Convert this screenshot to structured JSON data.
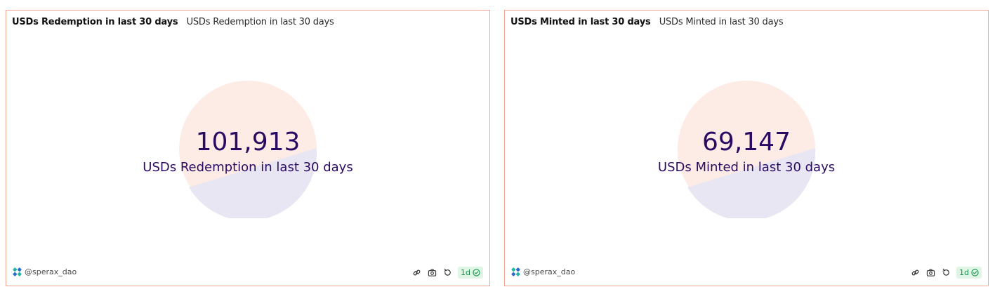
{
  "colors": {
    "border": "#f2a594",
    "counter_text": "#2b0a63",
    "pie_light": "#fdece5",
    "pie_dark": "#e8e6f2",
    "brand": "#1fb5a6",
    "fresh_text": "#1f8f4d",
    "fresh_bg": "#dff5e6"
  },
  "panels": [
    {
      "title": "USDs Redemption in last 30 days",
      "subtitle": "USDs Redemption in last 30 days",
      "counter_value": "101,913",
      "counter_label": "USDs Redemption in last 30 days",
      "owner": "@sperax_dao",
      "freshness": "1d",
      "icons": [
        "brand-logo-icon",
        "link-icon",
        "camera-icon",
        "refresh-icon",
        "check-circle-icon"
      ]
    },
    {
      "title": "USDs Minted in last 30 days",
      "subtitle": "USDs Minted in last 30 days",
      "counter_value": "69,147",
      "counter_label": "USDs Minted in last 30 days",
      "owner": "@sperax_dao",
      "freshness": "1d",
      "icons": [
        "brand-logo-icon",
        "link-icon",
        "camera-icon",
        "refresh-icon",
        "check-circle-icon"
      ]
    }
  ]
}
